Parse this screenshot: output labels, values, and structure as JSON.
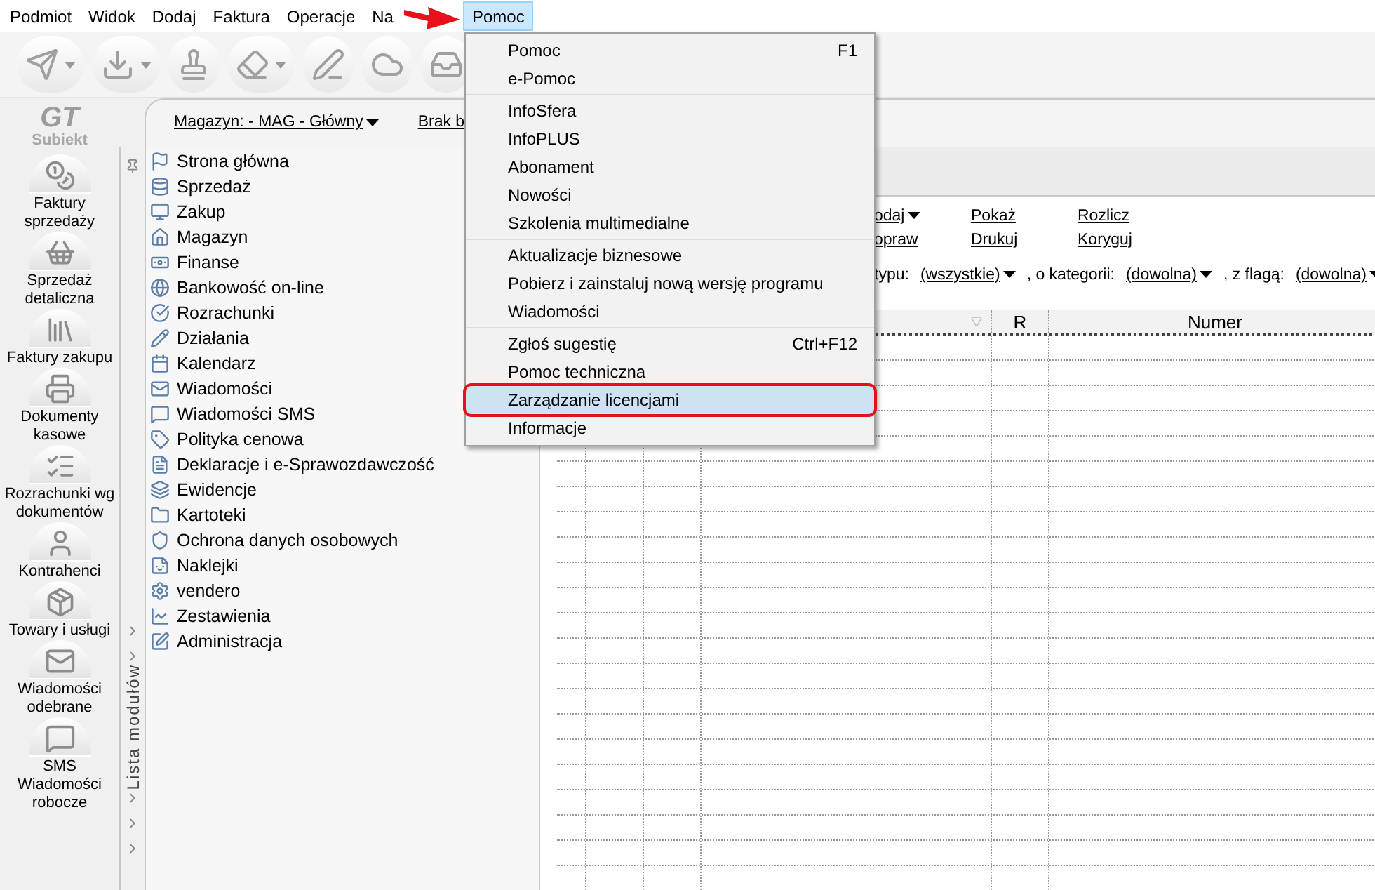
{
  "menu_bar": [
    {
      "label": "Podmiot",
      "selected": false
    },
    {
      "label": "Widok",
      "selected": false
    },
    {
      "label": "Dodaj",
      "selected": false
    },
    {
      "label": "Faktura",
      "selected": false
    },
    {
      "label": "Operacje",
      "selected": false
    },
    {
      "label": "Na",
      "selected": false
    },
    {
      "label": "Pomoc",
      "selected": true
    }
  ],
  "toolbar": [
    {
      "dropdown": true
    },
    {
      "dropdown": true
    },
    {
      "dropdown": false
    },
    {
      "dropdown": true
    },
    {
      "dropdown": false
    },
    {
      "dropdown": false
    },
    {
      "dropdown": false
    }
  ],
  "logo": {
    "mark": "GT",
    "name": "Subiekt"
  },
  "sidebar": [
    "Faktury sprzedaży",
    "Sprzedaż detaliczna",
    "Faktury zakupu",
    "Dokumenty kasowe",
    "Rozrachunki wg dokumentów",
    "Kontrahenci",
    "Towary i usługi",
    "Wiadomości odebrane",
    "SMS Wiadomości robocze"
  ],
  "header": {
    "warehouse": "Magazyn: - MAG - Główny",
    "status": "Brak b"
  },
  "modules_panel": {
    "title": "Lista modułów",
    "items": [
      "Strona główna",
      "Sprzedaż",
      "Zakup",
      "Magazyn",
      "Finanse",
      "Bankowość on-line",
      "Rozrachunki",
      "Działania",
      "Kalendarz",
      "Wiadomości",
      "Wiadomości SMS",
      "Polityka cenowa",
      "Deklaracje i e-Sprawozdawczość",
      "Ewidencje",
      "Kartoteki",
      "Ochrona danych osobowych",
      "Naklejki",
      "vendero",
      "Zestawienia",
      "Administracja"
    ]
  },
  "actions": [
    [
      "odaj",
      "opraw"
    ],
    [
      "Pokaż",
      "Drukuj"
    ],
    [
      "Rozlicz",
      "Koryguj"
    ]
  ],
  "action_dropdowns": [
    true,
    false
  ],
  "filters": {
    "label": "typu:",
    "type": "(wszystkie)",
    "category_label": ", o kategorii:",
    "category": "(dowolna)",
    "flag_label": ", z flagą:",
    "flag": "(dowolna)"
  },
  "table": {
    "columns": [
      "R",
      "Numer"
    ]
  },
  "help_menu": [
    [
      {
        "label": "Pomoc",
        "shortcut": "F1",
        "selected": false,
        "annotated": false
      },
      {
        "label": "e-Pomoc",
        "selected": false,
        "annotated": false
      }
    ],
    [
      {
        "label": "InfoSfera",
        "selected": false,
        "annotated": false
      },
      {
        "label": "InfoPLUS",
        "selected": false,
        "annotated": false
      },
      {
        "label": "Abonament",
        "selected": false,
        "annotated": false
      },
      {
        "label": "Nowości",
        "selected": false,
        "annotated": false
      },
      {
        "label": "Szkolenia multimedialne",
        "selected": false,
        "annotated": false
      }
    ],
    [
      {
        "label": "Aktualizacje biznesowe",
        "selected": false,
        "annotated": false
      },
      {
        "label": "Pobierz i zainstaluj nową wersję programu",
        "selected": false,
        "annotated": false
      },
      {
        "label": "Wiadomości",
        "selected": false,
        "annotated": false
      }
    ],
    [
      {
        "label": "Zgłoś sugestię",
        "shortcut": "Ctrl+F12",
        "selected": false,
        "annotated": false
      },
      {
        "label": "Pomoc techniczna",
        "selected": false,
        "annotated": false
      },
      {
        "label": "Zarządzanie licencjami",
        "selected": true,
        "annotated": true
      },
      {
        "label": "Informacje",
        "selected": false,
        "annotated": false
      }
    ]
  ]
}
